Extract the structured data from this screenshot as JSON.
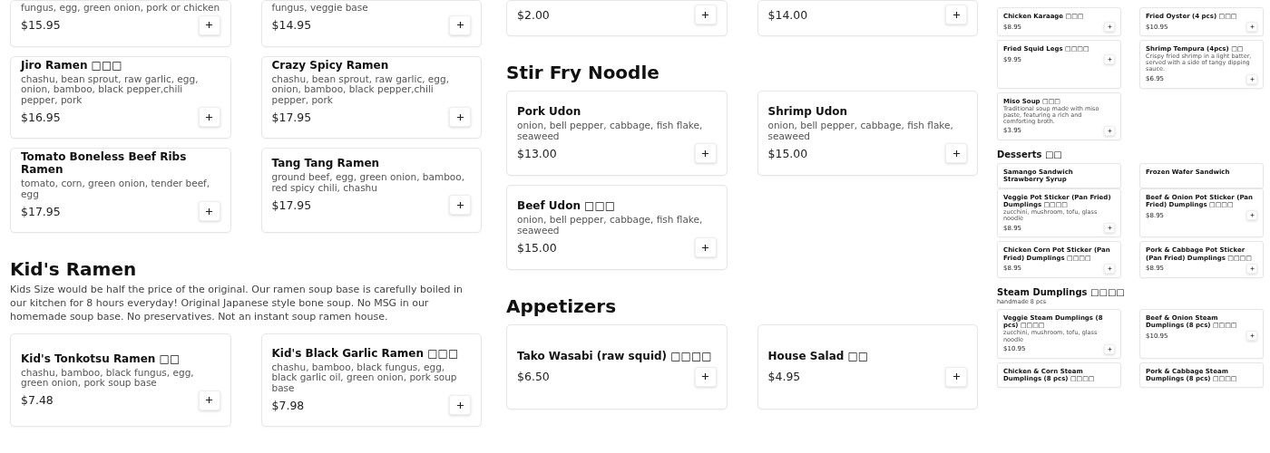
{
  "columns": [
    {
      "sections": [
        {
          "items": [
            {
              "description": "fungus, egg, green onion, pork or chicken",
              "price": "$15.95"
            },
            {
              "description": "fungus, veggie base",
              "price": "$14.95"
            },
            {
              "name": "Jiro Ramen □□□",
              "description": "chashu, bean sprout, raw garlic, egg, onion, bamboo, black pepper,chili pepper, pork",
              "price": "$16.95"
            },
            {
              "name": "Crazy Spicy Ramen",
              "description": "chashu, bean sprout, raw garlic, egg, onion, bamboo, black pepper,chili pepper, pork",
              "price": "$17.95"
            },
            {
              "name": "Tomato Boneless Beef Ribs Ramen",
              "description": "tomato, corn, green onion, tender beef, egg",
              "price": "$17.95"
            },
            {
              "name": "Tang Tang Ramen",
              "description": "ground beef, egg, green onion, bamboo, red spicy chili, chashu",
              "price": "$17.95"
            }
          ]
        },
        {
          "heading": "Kid's Ramen",
          "description": "Kids Size would be half the price of the original. Our ramen soup base is carefully boiled in our kitchen for 8 hours everyday! Original Japanese style bone soup. No MSG in our homemade soup base. No preservatives. Not an instant soup ramen house.",
          "items": [
            {
              "name": "Kid's Tonkotsu Ramen □□",
              "description": "chashu, bamboo, black fungus, egg, green onion, pork soup base",
              "price": "$7.48"
            },
            {
              "name": "Kid's Black Garlic Ramen □□□",
              "description": "chashu, bamboo, black fungus, egg, black garlic oil, green onion, pork soup base",
              "price": "$7.98"
            }
          ]
        }
      ]
    },
    {
      "sections": [
        {
          "items": [
            {
              "price": "$2.00"
            },
            {
              "price": "$14.00"
            }
          ]
        },
        {
          "heading": "Stir Fry Noodle",
          "items": [
            {
              "name": "Pork Udon",
              "description": "onion, bell pepper, cabbage, fish flake, seaweed",
              "price": "$13.00"
            },
            {
              "name": "Shrimp Udon",
              "description": "onion, bell pepper, cabbage, fish flake, seaweed",
              "price": "$15.00"
            },
            {
              "name": "Beef Udon □□□",
              "description": "onion, bell pepper, cabbage, fish flake, seaweed",
              "price": "$15.00"
            }
          ]
        },
        {
          "heading": "Appetizers",
          "items": [
            {
              "name": "Tako Wasabi (raw squid) □□□□",
              "price": "$6.50"
            },
            {
              "name": "House Salad □□",
              "price": "$4.95"
            }
          ]
        }
      ]
    },
    {
      "sections": [
        {
          "items": [
            {
              "name": "Chicken Karaage □□□",
              "price": "$8.95"
            },
            {
              "name": "Fried Oyster (4 pcs) □□□",
              "price": "$10.95"
            },
            {
              "name": "Fried Squid Legs □□□□",
              "price": "$9.95"
            },
            {
              "name": "Shrimp Tempura (4pcs) □□",
              "description": "Crispy fried shrimp in a light batter, served with a side of tangy dipping sauce.",
              "price": "$6.95"
            },
            {
              "name": "Miso Soup □□□",
              "description": "Traditional soup made with miso paste, featuring a rich and comforting broth.",
              "price": "$3.95"
            }
          ]
        },
        {
          "heading": "Desserts □□",
          "items": [
            {
              "name": "Samango Sandwich Strawberry Syrup"
            },
            {
              "name": "Frozen Wafer Sandwich"
            }
          ]
        },
        {
          "items": [
            {
              "name": "Veggie Pot Sticker (Pan Fried) Dumplings □□□□",
              "description": "zucchini, mushroom, tofu, glass noodle",
              "price": "$8.95"
            },
            {
              "name": "Beef & Onion Pot Sticker (Pan Fried) Dumplings □□□□",
              "price": "$8.95"
            },
            {
              "name": "Chicken Corn Pot Sticker (Pan Fried) Dumplings □□□□",
              "price": "$8.95"
            },
            {
              "name": "Pork & Cabbage Pot Sticker (Pan Fried) Dumplings □□□□",
              "price": "$8.95"
            }
          ]
        },
        {
          "heading": "Steam Dumplings □□□□",
          "description": "handmade 8 pcs",
          "items": [
            {
              "name": "Veggie Steam Dumplings (8 pcs) □□□□",
              "description": "zucchini, mushroom, tofu, glass noodle",
              "price": "$10.95"
            },
            {
              "name": "Beef & Onion Steam Dumplings (8 pcs) □□□□",
              "price": "$10.95"
            },
            {
              "name": "Chicken & Corn Steam Dumplings (8 pcs) □□□□"
            },
            {
              "name": "Pork & Cabbage Steam Dumplings (8 pcs) □□□□"
            }
          ]
        }
      ]
    }
  ]
}
